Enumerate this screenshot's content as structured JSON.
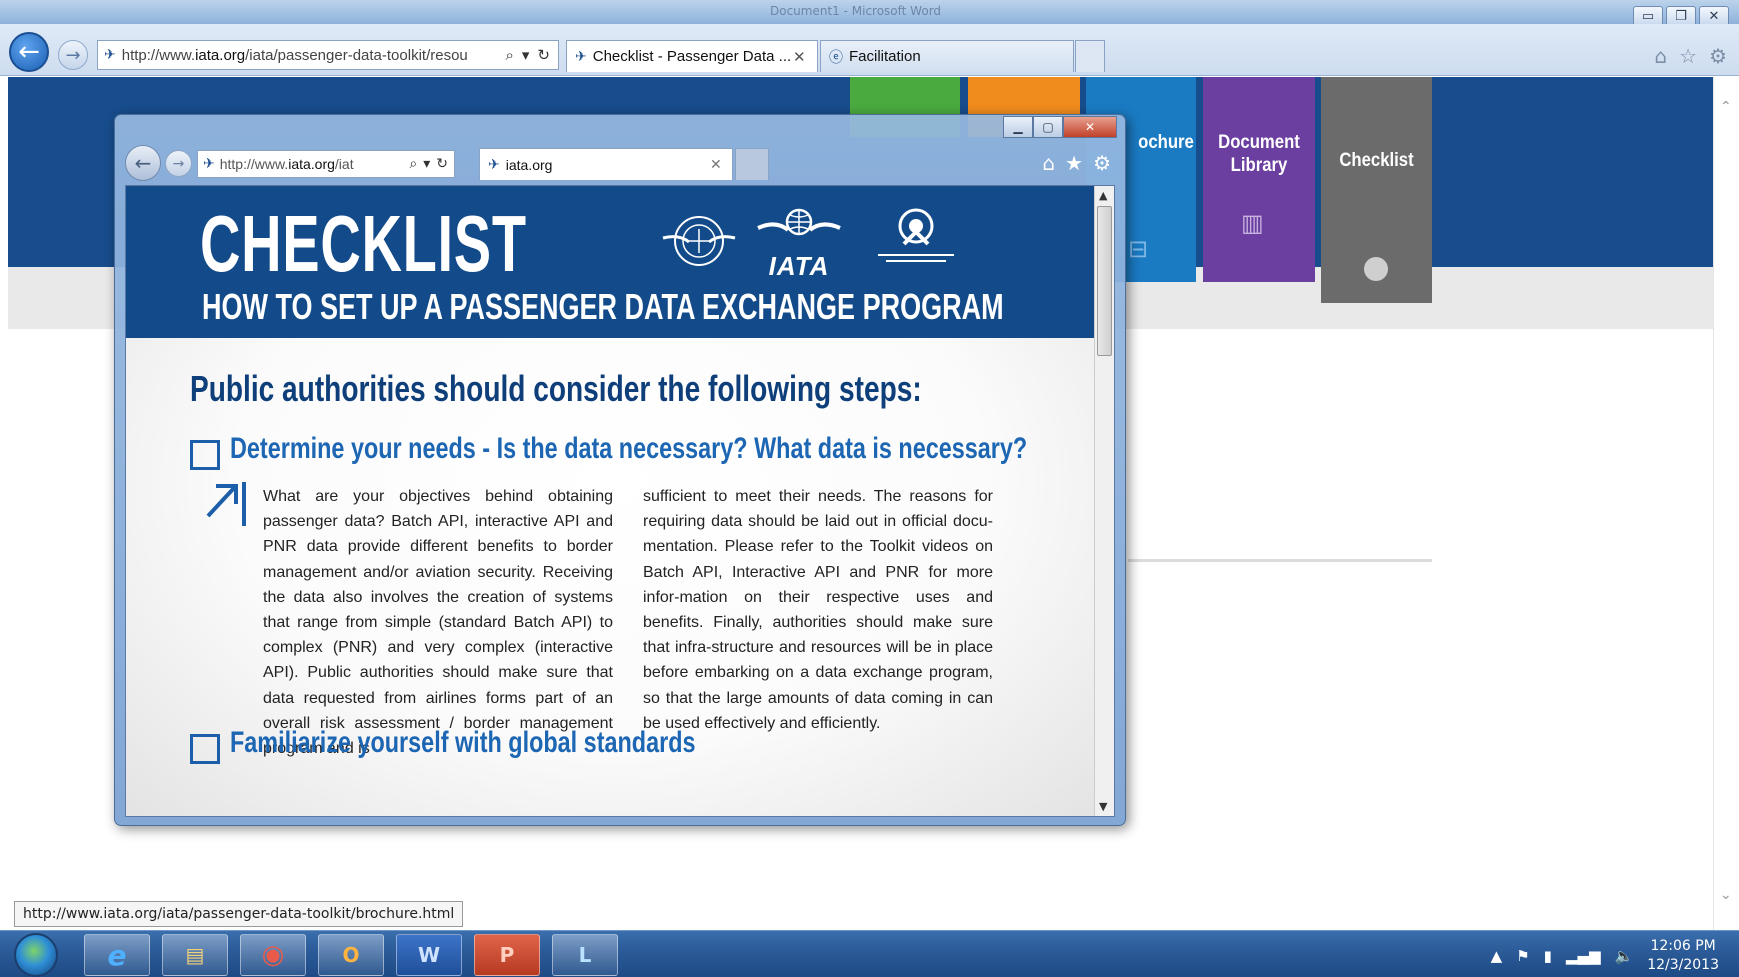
{
  "outer": {
    "title_text": "Document1 - Microsoft Word",
    "address_prefix": "http://www.",
    "address_host": "iata.org",
    "address_suffix": "/iata/passenger-data-toolkit/resou",
    "tabs": [
      {
        "label": "Checklist - Passenger Data ...",
        "close": "✕"
      },
      {
        "label": "Facilitation"
      }
    ],
    "status_url": "http://www.iata.org/iata/passenger-data-toolkit/brochure.html"
  },
  "site_tabs": [
    {
      "label": "ochure",
      "color": "#1a7bc3"
    },
    {
      "label": "Document Library",
      "color": "#6b3fa0"
    },
    {
      "label": "Checklist",
      "color": "#6b6b6b"
    }
  ],
  "popup": {
    "address_prefix": "http://www.",
    "address_host": "iata.org",
    "address_suffix": "/iat",
    "tab_label": "iata.org",
    "tab_close": "✕"
  },
  "document": {
    "title": "CHECKLIST",
    "subtitle": "HOW TO SET UP A PASSENGER DATA EXCHANGE PROGRAM",
    "logos": {
      "iata": "IATA"
    },
    "heading": "Public authorities should consider the following steps:",
    "steps": [
      {
        "label": "Determine your needs - Is the data necessary? What data is necessary?"
      },
      {
        "label": "Familiarize yourself with global standards"
      }
    ],
    "col1": "What are your objectives behind obtaining passenger data? Batch API, interactive API and PNR data provide different benefits to border management and/or aviation security. Receiving the data also involves the creation of systems that range from simple (standard Batch API) to complex (PNR) and very complex (interactive API). Public authorities should make sure that data requested from airlines forms part of an overall risk assessment / border management program and is",
    "col2": "sufficient to meet their needs. The reasons for requiring data should be laid out in official docu-mentation. Please refer to the Toolkit videos on Batch API, Interactive API and PNR for more infor-mation on their respective uses and benefits. Finally, authorities should make sure that infra-structure and resources will be in place before embarking on a data exchange program, so that the large amounts of data coming in can be used effectively and efficiently."
  },
  "taskbar": {
    "apps": [
      "e",
      "▤",
      "◉",
      "O",
      "W",
      "P",
      "L"
    ],
    "time": "12:06 PM",
    "date": "12/3/2013"
  },
  "colors": {
    "iata_blue": "#134b8a",
    "step_blue": "#1c66b3"
  }
}
